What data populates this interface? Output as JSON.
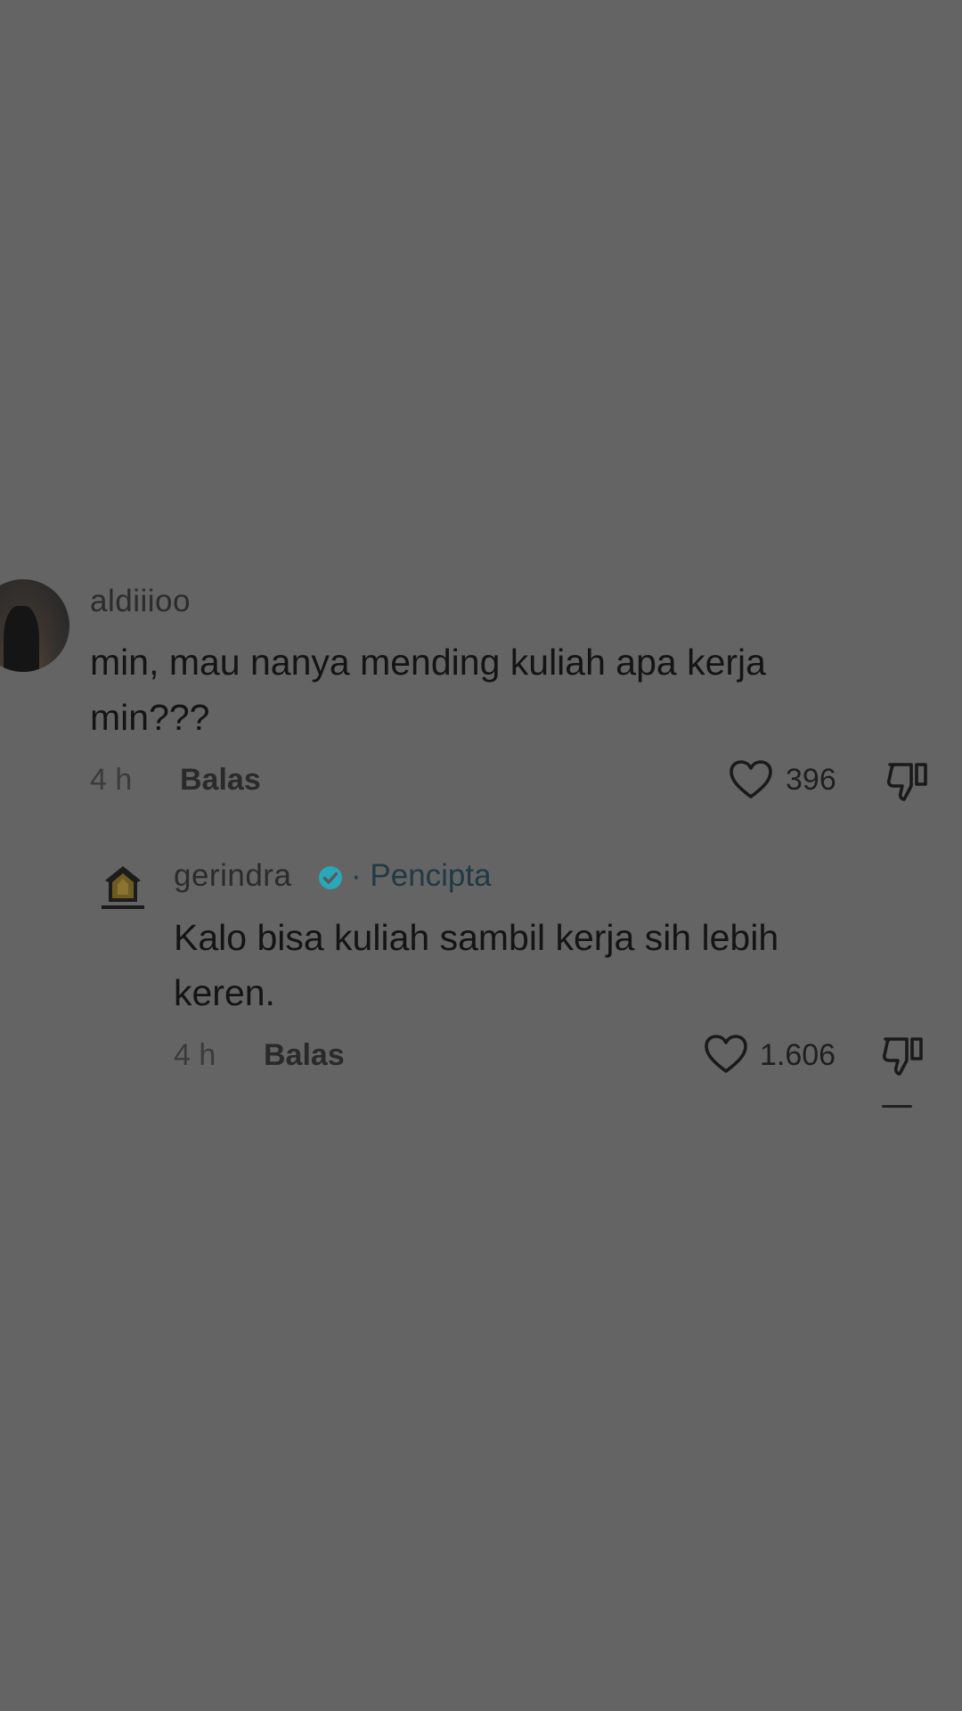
{
  "comments": [
    {
      "username": "aldiiioo",
      "text": "min, mau nanya mending kuliah apa kerja min???",
      "time": "4 h",
      "reply_label": "Balas",
      "likes": "396"
    },
    {
      "username": "gerindra",
      "creator_label": "· Pencipta",
      "text": "Kalo bisa kuliah sambil kerja sih lebih keren.",
      "time": "4 h",
      "reply_label": "Balas",
      "likes": "1.606"
    }
  ],
  "icons": {
    "like": "heart-outline-icon",
    "dislike": "thumbs-down-icon",
    "verified": "verified-badge-icon"
  },
  "colors": {
    "background": "#646464",
    "verified": "#2aa7b8",
    "creator_text": "#1f3a44"
  }
}
